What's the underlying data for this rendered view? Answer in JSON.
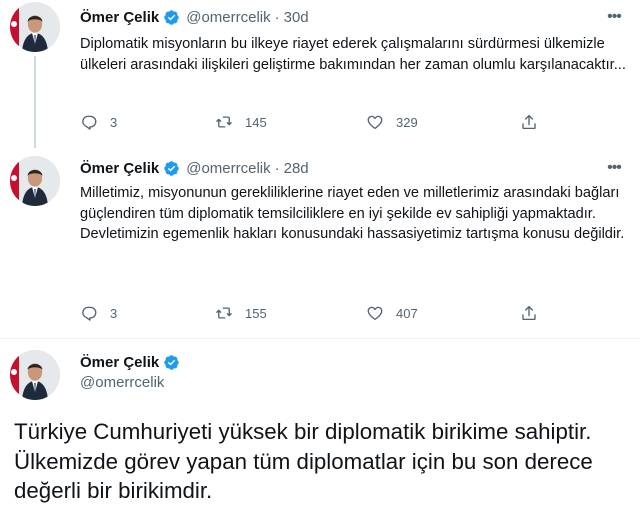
{
  "tweets": [
    {
      "name": "Ömer Çelik",
      "handle": "@omerrcelik",
      "separator": "·",
      "age": "30d",
      "text": "Diplomatik misyonların bu ilkeye riayet ederek çalışmalarını sürdürmesi ülkemizle ülkeleri arasındaki ilişkileri geliştirme bakımından her zaman olumlu karşılanacaktır...",
      "replies": "3",
      "retweets": "145",
      "likes": "329"
    },
    {
      "name": "Ömer Çelik",
      "handle": "@omerrcelik",
      "separator": "·",
      "age": "28d",
      "text_p1": "Milletimiz, misyonunun gerekliliklerine riayet eden ve milletlerimiz arasındaki bağları güçlendiren tüm diplomatik temsilciliklere en iyi şekilde ev sahipliği yapmaktadır.",
      "text_p2": "Devletimizin egemenlik hakları konusundaki hassasiyetimiz tartışma konusu değildir.",
      "replies": "3",
      "retweets": "155",
      "likes": "407"
    }
  ],
  "featured": {
    "name": "Ömer Çelik",
    "handle": "@omerrcelik",
    "text": "Türkiye Cumhuriyeti yüksek bir diplomatik birikime sahiptir. Ülkemizde görev yapan tüm diplomatlar için bu son derece değerli bir birikimdir."
  },
  "icons": {
    "verified": "verified-badge-icon",
    "more": "more-options-icon",
    "reply": "reply-icon",
    "retweet": "retweet-icon",
    "like": "like-icon",
    "share": "share-icon"
  },
  "colors": {
    "text": "#0f1419",
    "secondary": "#536471",
    "verified": "#1d9bf0",
    "thread_line": "#cfd9de"
  }
}
